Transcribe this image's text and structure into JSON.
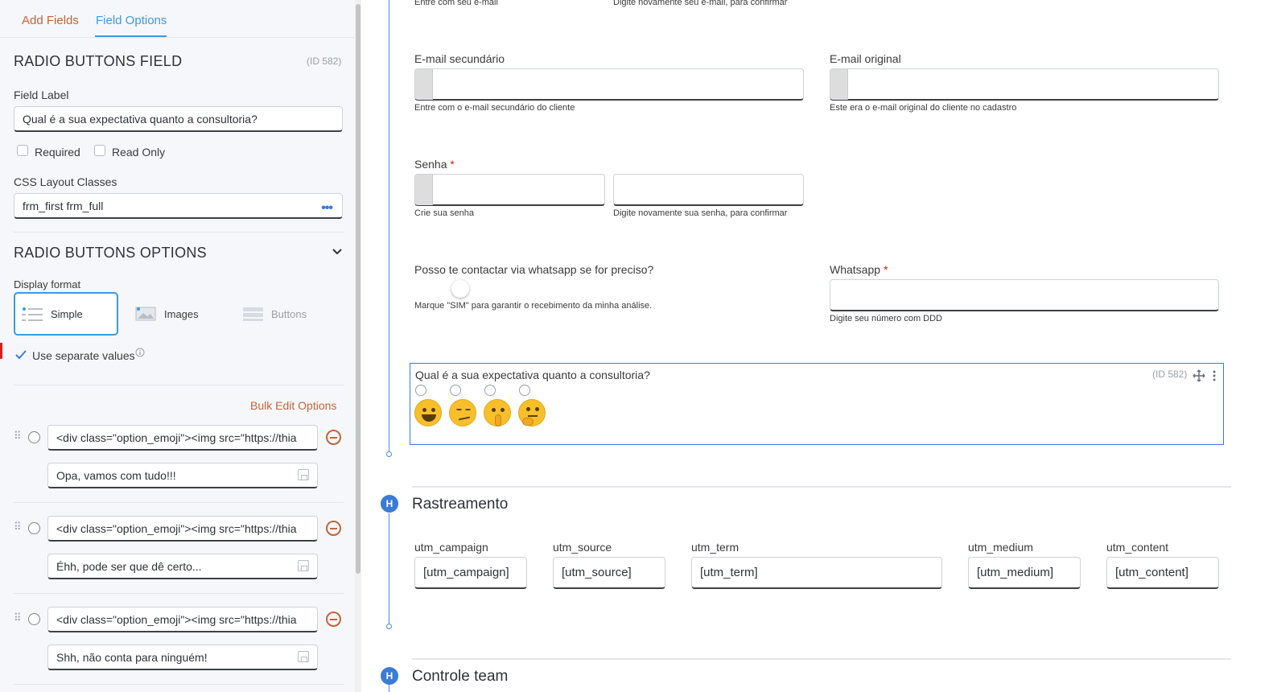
{
  "tabs": {
    "add_fields": "Add Fields",
    "field_options": "Field Options"
  },
  "field_section": {
    "title": "RADIO BUTTONS FIELD",
    "id_tag": "(ID 582)"
  },
  "field_label": {
    "label": "Field Label",
    "value": "Qual é a sua expectativa quanto a consultoria?"
  },
  "checkboxes": {
    "required": "Required",
    "read_only": "Read Only"
  },
  "css_classes": {
    "label": "CSS Layout Classes",
    "value": "frm_first frm_full",
    "more": "•••"
  },
  "options_section": {
    "title": "RADIO BUTTONS OPTIONS"
  },
  "display_format": {
    "label": "Display format",
    "options": [
      {
        "label": "Simple",
        "selected": true
      },
      {
        "label": "Images",
        "selected": false
      },
      {
        "label": "Buttons",
        "selected": false
      }
    ]
  },
  "separate_values": {
    "label": "Use separate values",
    "checked": true
  },
  "bulk_edit": "Bulk Edit Options",
  "options": [
    {
      "html": "<div class=\"option_emoji\"><img src=\"https://thia",
      "value": "Opa, vamos com tudo!!!"
    },
    {
      "html": "<div class=\"option_emoji\"><img src=\"https://thia",
      "value": "Éhh, pode ser que dê certo..."
    },
    {
      "html": "<div class=\"option_emoji\"><img src=\"https://thia",
      "value": "Shh, não conta para ninguém!"
    }
  ],
  "form": {
    "top_descs": {
      "left": "Entre com seu e-mail",
      "right": "Digite novamente seu e-mail, para confirmar"
    },
    "email_secondary": {
      "label": "E-mail secundário",
      "desc": "Entre com o e-mail secundário do cliente"
    },
    "email_original": {
      "label": "E-mail original",
      "desc": "Este era o e-mail original do cliente no cadastro"
    },
    "password": {
      "label": "Senha",
      "required_mark": "*",
      "desc1": "Crie sua senha",
      "desc2": "Digite novamente sua senha, para confirmar"
    },
    "whatsapp_contact": {
      "label": "Posso te contactar via whatsapp se for preciso?",
      "desc": "Marque \"SIM\" para garantir o recebimento da minha análise."
    },
    "whatsapp": {
      "label": "Whatsapp",
      "required_mark": "*",
      "desc": "Digite seu número com DDD"
    },
    "expectation": {
      "label": "Qual é a sua expectativa quanto a consultoria?",
      "id_tag": "(ID 582)"
    },
    "sections": [
      {
        "badge": "H",
        "title": "Rastreamento"
      },
      {
        "badge": "H",
        "title": "Controle team"
      }
    ],
    "utm_fields": [
      {
        "label": "utm_campaign",
        "value": "[utm_campaign]"
      },
      {
        "label": "utm_source",
        "value": "[utm_source]"
      },
      {
        "label": "utm_term",
        "value": "[utm_term]"
      },
      {
        "label": "utm_medium",
        "value": "[utm_medium]"
      },
      {
        "label": "utm_content",
        "value": "[utm_content]"
      }
    ]
  },
  "colors": {
    "accent": "#4199dc",
    "secondary": "#c0653a",
    "required": "#d81e1e"
  }
}
